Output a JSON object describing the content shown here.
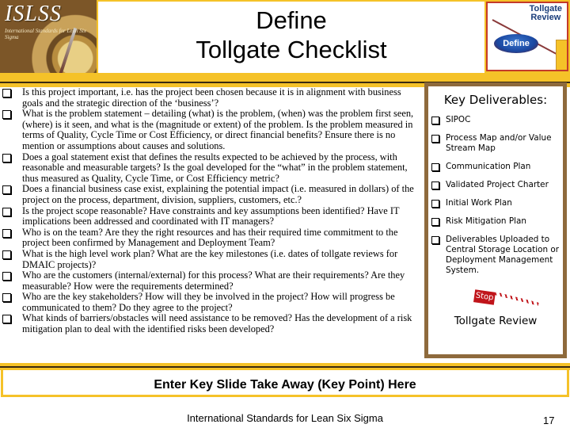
{
  "header": {
    "logo_text": "ISLSS",
    "logo_subtext": "International Standards for Lean Six Sigma",
    "title_line1": "Define",
    "title_line2": "Tollgate Checklist",
    "tollgate_logo": {
      "title_line1": "Tollgate",
      "title_line2": "Review",
      "phase_label": "Define"
    }
  },
  "checklist": [
    "Is this project important, i.e. has the project been chosen because it is in alignment with business goals and the strategic direction of the ‘business’?",
    "What is the problem statement – detailing (what) is the problem, (when) was the problem first seen, (where) is it seen, and what is the (magnitude or extent) of the problem.  Is the problem measured in terms of Quality, Cycle Time or Cost Efficiency, or direct financial benefits? Ensure there is no mention or assumptions about causes and solutions.",
    "Does a goal statement exist that defines the results expected to be achieved by the process, with reasonable and measurable targets?  Is the goal developed for the “what” in the problem statement, thus measured as Quality, Cycle Time, or Cost Efficiency metric?",
    "Does a financial business case exist, explaining the potential impact (i.e. measured in dollars) of the project on the process, department, division, suppliers, customers, etc.?",
    "Is the project scope reasonable?  Have constraints and key assumptions been identified?  Have IT implications been addressed and coordinated with IT managers?",
    "Who is on the team?  Are they the right resources and has their required time commitment to the project been confirmed by Management and Deployment Team?",
    "What is the high level work plan?  What are the key milestones (i.e. dates of tollgate reviews for DMAIC projects)?",
    "Who are the customers (internal/external) for this process?  What are their requirements?  Are they measurable?  How were the requirements determined?",
    "Who are the key stakeholders?  How will they be involved in the project?  How will progress be communicated to them?  Do they agree to the project?",
    "What kinds of barriers/obstacles will need assistance to be removed?  Has the development of a risk mitigation plan to deal with the identified risks been developed?"
  ],
  "deliverables": {
    "title": "Key Deliverables:",
    "items": [
      "SIPOC",
      "Process Map and/or Value Stream Map",
      "Communication Plan",
      "Validated Project Charter",
      "Initial Work Plan",
      "Risk Mitigation Plan",
      "Deliverables Uploaded to Central Storage Location or Deployment Management System."
    ],
    "stop_label": "Stop",
    "tollgate_review_label": "Tollgate Review"
  },
  "keypoint": "Enter Key Slide Take Away (Key Point) Here",
  "footer": {
    "organization": "International Standards for Lean Six Sigma",
    "page_number": "17"
  },
  "colors": {
    "accent_gold": "#f5c228",
    "frame_brown": "#8e6a3c",
    "stop_red": "#c0141a"
  }
}
